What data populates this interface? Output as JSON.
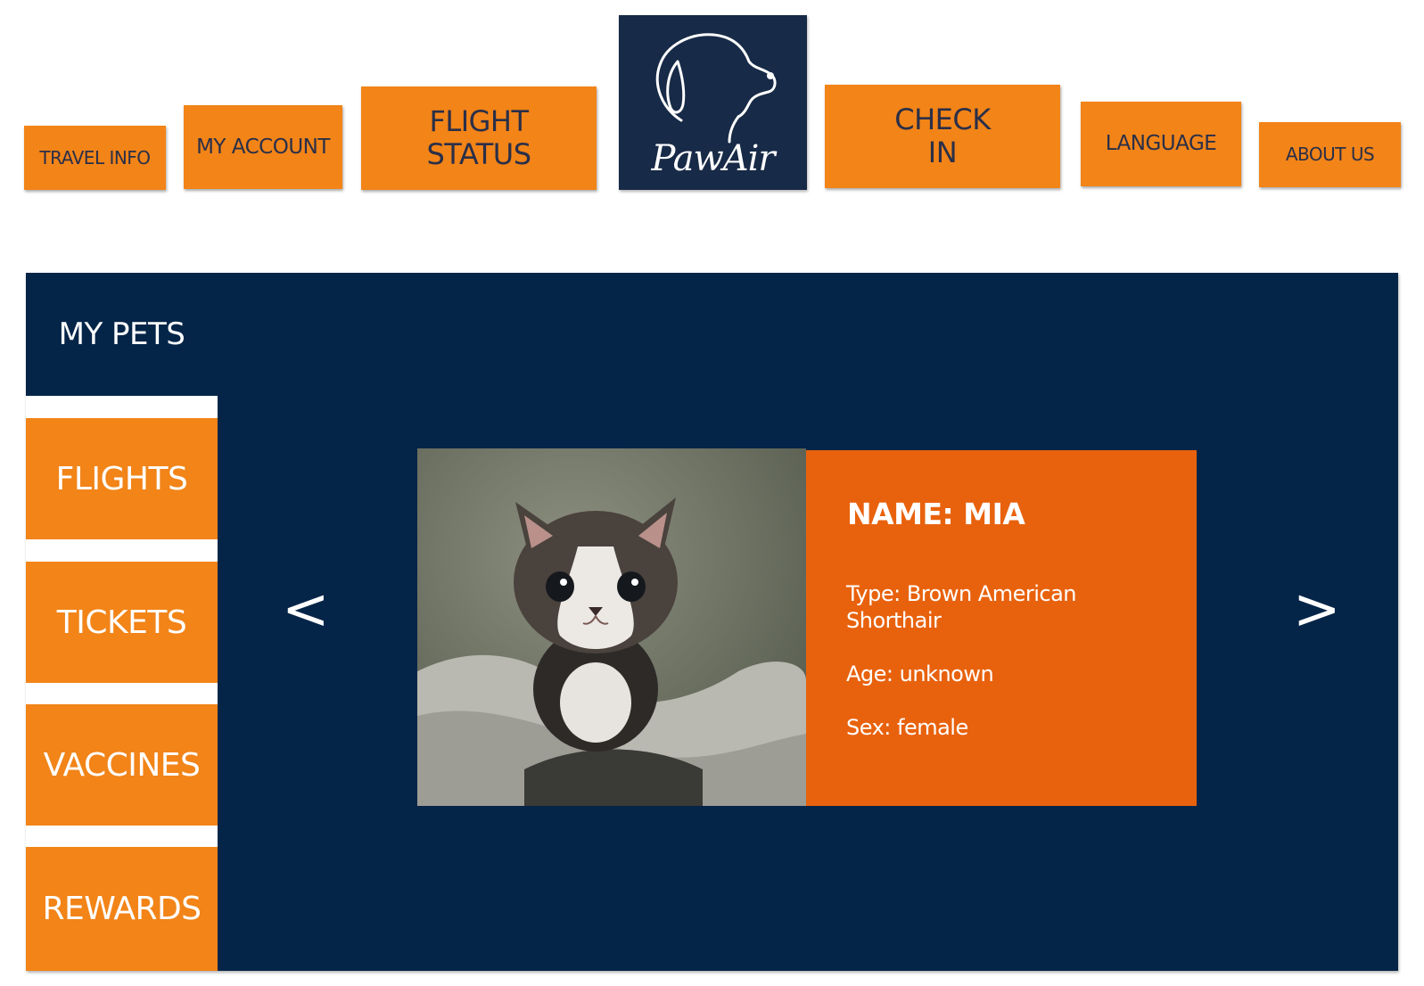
{
  "nav": {
    "travel_info": "TRAVEL INFO",
    "my_account": "MY ACCOUNT",
    "flight_status": "FLIGHT\nSTATUS",
    "check_in": "CHECK\nIN",
    "language": "LANGUAGE",
    "about_us": "ABOUT US"
  },
  "logo": {
    "text": "PawAir",
    "icon": "dog-head-outline-icon"
  },
  "sidebar": {
    "active": "MY PETS",
    "items": [
      "FLIGHTS",
      "TICKETS",
      "VACCINES",
      "REWARDS"
    ]
  },
  "pet": {
    "name_label": "NAME:  MIA",
    "type": "Type: Brown American Shorthair",
    "age": "Age: unknown",
    "sex": "Sex: female",
    "photo": "kitten-photo"
  },
  "carousel": {
    "prev": "<",
    "next": ">"
  },
  "colors": {
    "orange": "#f28418",
    "card_orange": "#e8620d",
    "navy": "#042548",
    "logo_navy": "#172a47"
  }
}
